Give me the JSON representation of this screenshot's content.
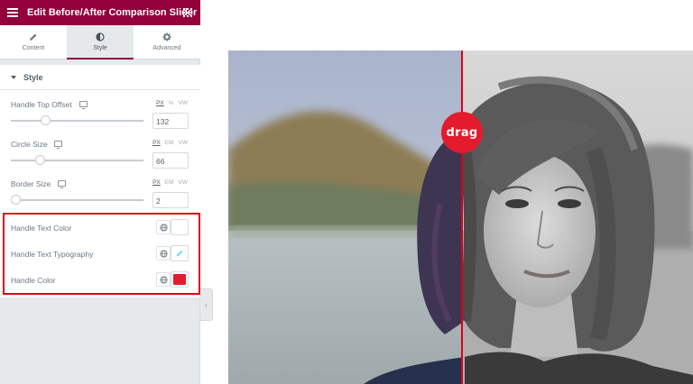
{
  "header": {
    "title": "Edit Before/After Comparison Slider",
    "menu_icon": "hamburger-icon",
    "apps_icon": "grid-icon"
  },
  "tabs": [
    {
      "label": "Content",
      "icon": "pencil-icon"
    },
    {
      "label": "Style",
      "icon": "half-circle-icon",
      "active": true
    },
    {
      "label": "Advanced",
      "icon": "gear-icon"
    }
  ],
  "section": {
    "title": "Style"
  },
  "controls": {
    "handle_top_offset": {
      "label": "Handle Top Offset",
      "units": [
        "PX",
        "%",
        "VW"
      ],
      "selected_unit": "PX",
      "value": "132",
      "slider_fraction": 0.26
    },
    "circle_size": {
      "label": "Circle Size",
      "units": [
        "PX",
        "EM",
        "VW"
      ],
      "selected_unit": "PX",
      "value": "66",
      "slider_fraction": 0.22
    },
    "border_size": {
      "label": "Border Size",
      "units": [
        "PX",
        "EM",
        "VW"
      ],
      "selected_unit": "PX",
      "value": "2",
      "slider_fraction": 0.0
    }
  },
  "style_rows": {
    "handle_text_color": {
      "label": "Handle Text Color"
    },
    "handle_text_typography": {
      "label": "Handle Text Typography"
    },
    "handle_color": {
      "label": "Handle Color",
      "swatch": "#e31b2d"
    }
  },
  "preview": {
    "handle_label": "drag",
    "handle_color": "#e31b2d",
    "divider_color": "#dd0016"
  },
  "colors": {
    "brand": "#93003c",
    "highlight": "#dd0016"
  }
}
